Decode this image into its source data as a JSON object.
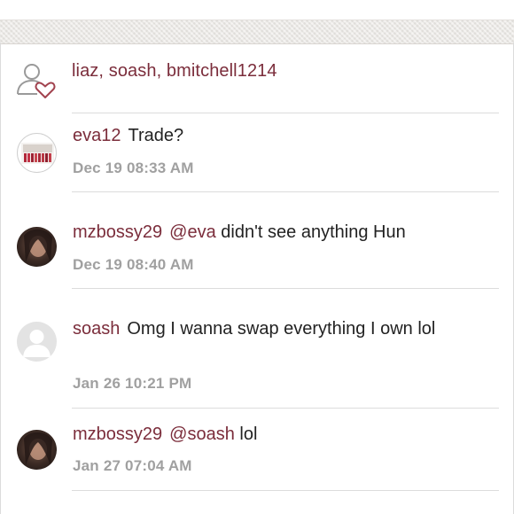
{
  "likes": {
    "icon": "user-heart-icon",
    "text": "liaz, soash, bmitchell1214"
  },
  "comments": [
    {
      "username": "eva12",
      "mention": "",
      "text": "Trade?",
      "timestamp": "Dec 19 08:33 AM",
      "avatar": "photo"
    },
    {
      "username": "mzbossy29",
      "mention": "@eva",
      "text": "didn't see anything Hun",
      "timestamp": "Dec 19 08:40 AM",
      "avatar": "photo"
    },
    {
      "username": "soash",
      "mention": "",
      "text": "Omg I wanna swap everything I own lol",
      "timestamp": "Jan 26 10:21 PM",
      "avatar": "default-user-icon"
    },
    {
      "username": "mzbossy29",
      "mention": "@soash",
      "text": "lol",
      "timestamp": "Jan 27 07:04 AM",
      "avatar": "photo"
    }
  ],
  "colors": {
    "username": "#7b2d3b",
    "timestamp": "#a0a0a0",
    "text": "#222222",
    "divider": "#dcdcdc"
  }
}
